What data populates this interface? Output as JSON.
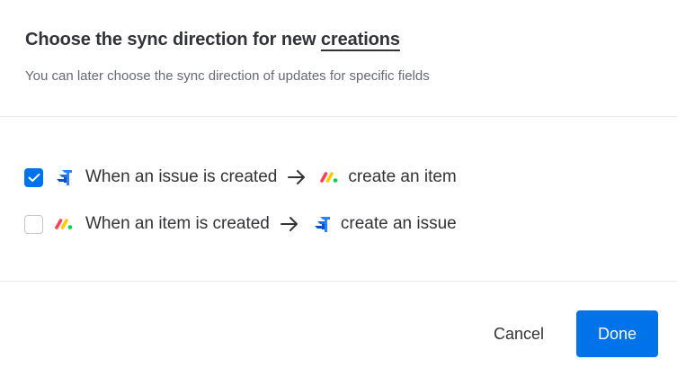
{
  "dialog": {
    "title_prefix": "Choose the sync direction for new ",
    "title_emphasis": "creations",
    "subtitle": "You can later choose the sync direction of updates for specific fields"
  },
  "options": [
    {
      "checked": true,
      "source_icon": "jira-logo-icon",
      "source_text": "When an issue is created",
      "arrow_icon": "arrow-right-icon",
      "target_icon": "monday-logo-icon",
      "target_text": "create an item"
    },
    {
      "checked": false,
      "source_icon": "monday-logo-icon",
      "source_text": "When an item is created",
      "arrow_icon": "arrow-right-icon",
      "target_icon": "jira-logo-icon",
      "target_text": "create an issue"
    }
  ],
  "footer": {
    "cancel_label": "Cancel",
    "done_label": "Done"
  },
  "colors": {
    "primary": "#0073ea",
    "text": "#323338",
    "secondary_text": "#676879",
    "divider": "#e6e9ef",
    "jira_blue": "#2684ff",
    "monday_red": "#ff3d57",
    "monday_yellow": "#ffcb00",
    "monday_green": "#00d647"
  }
}
